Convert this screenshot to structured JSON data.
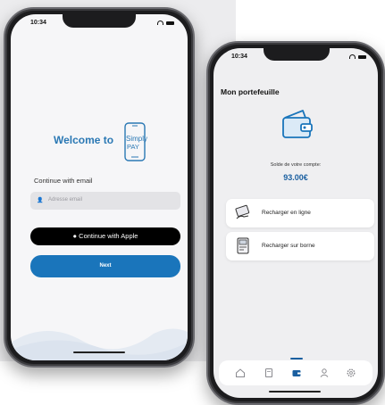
{
  "status_bar": {
    "time_left": "10:34",
    "time_right": "10:34"
  },
  "login": {
    "welcome": "Welcome to",
    "logo_line1": "Simply",
    "logo_line2": "PAY",
    "continue_email_label": "Continue with email",
    "email_placeholder": "Adresse email",
    "apple_button": "Continue with Apple",
    "next_button": "Next"
  },
  "wallet": {
    "title": "Mon portefeuille",
    "balance_label": "Solde de votre compte:",
    "balance_value": "93.00€",
    "actions": [
      {
        "label": "Recharger en ligne",
        "icon": "card-hand-icon"
      },
      {
        "label": "Recharger sur borne",
        "icon": "terminal-icon"
      }
    ],
    "tabs": [
      {
        "icon": "home-icon",
        "active": false
      },
      {
        "icon": "receipt-icon",
        "active": false
      },
      {
        "icon": "wallet-icon",
        "active": true
      },
      {
        "icon": "profile-icon",
        "active": false
      },
      {
        "icon": "settings-icon",
        "active": false
      }
    ]
  },
  "colors": {
    "accent": "#1a75bb",
    "balance": "#1a5fa0",
    "apple_button": "#000000"
  }
}
